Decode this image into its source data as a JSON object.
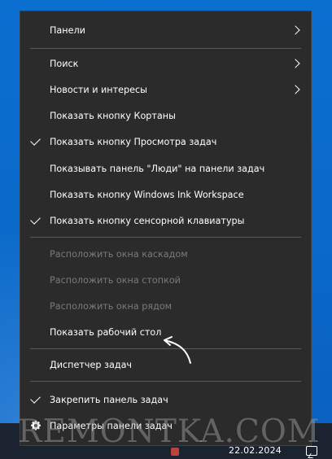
{
  "menu": {
    "items": [
      {
        "label": "Панели",
        "submenu": true
      },
      {
        "label": "Поиск",
        "submenu": true
      },
      {
        "label": "Новости и интересы",
        "submenu": true
      },
      {
        "label": "Показать кнопку Кортаны"
      },
      {
        "label": "Показать кнопку Просмотра задач",
        "checked": true
      },
      {
        "label": "Показывать панель \"Люди\" на панели задач"
      },
      {
        "label": "Показать кнопку Windows Ink Workspace"
      },
      {
        "label": "Показать кнопку сенсорной клавиатуры",
        "checked": true
      },
      {
        "label": "Расположить окна каскадом",
        "disabled": true
      },
      {
        "label": "Расположить окна стопкой",
        "disabled": true
      },
      {
        "label": "Расположить окна рядом",
        "disabled": true
      },
      {
        "label": "Показать рабочий стол"
      },
      {
        "label": "Диспетчер задач"
      },
      {
        "label": "Закрепить панель задач",
        "checked": true
      },
      {
        "label": "Параметры панели задач",
        "icon": "gear-icon"
      }
    ]
  },
  "taskbar": {
    "date": "22.02.2024"
  },
  "watermark": {
    "text": "REMONTKA.COM"
  },
  "colors": {
    "menu_bg": "#2b2b2b",
    "desktop": "#0a68c8",
    "taskbar": "#1b2331",
    "text": "#ffffff",
    "disabled_text": "#7a7a7a"
  }
}
